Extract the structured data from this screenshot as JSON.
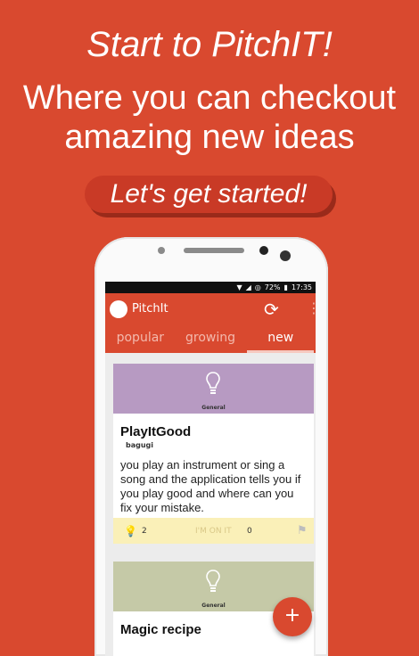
{
  "promo": {
    "headline": "Start to PitchIT!",
    "subline": "Where you can checkout amazing new ideas",
    "cta_label": "Let's get started!"
  },
  "status_bar": {
    "battery": "72%",
    "time": "17:35"
  },
  "app": {
    "name": "PitchIt",
    "tabs": [
      {
        "label": "popular"
      },
      {
        "label": "growing"
      },
      {
        "label": "new"
      }
    ],
    "selected_tab": "new"
  },
  "cards": [
    {
      "category": "General",
      "title": "PlayItGood",
      "author": "bagugi",
      "description": "you play an instrument or sing a song and the application tells you if you play good and where can you fix your mistake.",
      "likes": "2",
      "on_it_label": "I'M ON IT",
      "on_it_count": "0",
      "header_color": "#b79ac2"
    },
    {
      "category": "General",
      "title": "Magic recipe",
      "header_color": "#c5c9a7"
    }
  ],
  "fab_label": "+",
  "colors": {
    "primary": "#d9492f",
    "card_footer": "#faf0b8"
  },
  "icons": [
    "wifi-icon",
    "signal-icon",
    "alarm-icon",
    "refresh-icon",
    "overflow-menu-icon",
    "bulb-icon",
    "flag-icon",
    "plus-icon"
  ]
}
